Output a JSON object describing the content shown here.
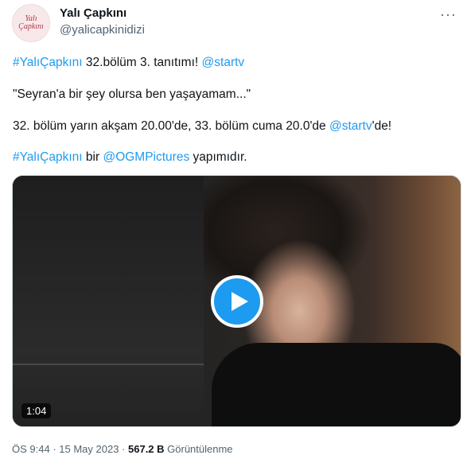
{
  "author": {
    "name": "Yalı Çapkını",
    "handle": "@yalicapkinidizi",
    "avatar_text_line1": "Yalı",
    "avatar_text_line2": "Çapkını"
  },
  "more_menu": "···",
  "tweet": {
    "line1": {
      "hashtag": "#YalıÇapkını",
      "text": " 32.bölüm 3. tanıtımı! ",
      "mention": "@startv"
    },
    "line2": "\"Seyran'a bir şey olursa ben yaşayamam...\"",
    "line3": {
      "text": "32. bölüm yarın akşam 20.00'de, 33. bölüm cuma 20.0'de ",
      "mention": "@startv",
      "suffix": "'de!"
    },
    "line4": {
      "hashtag": "#YalıÇapkını",
      "text_a": " bir ",
      "mention": "@OGMPictures",
      "text_b": " yapımıdır."
    }
  },
  "video": {
    "duration": "1:04",
    "play_icon": "play-icon",
    "accent": "#1d9bf0"
  },
  "meta": {
    "time": "ÖS 9:44",
    "sep1": " · ",
    "date": "15 May 2023",
    "sep2": " · ",
    "views": "567.2 B",
    "views_label": " Görüntülenme"
  }
}
